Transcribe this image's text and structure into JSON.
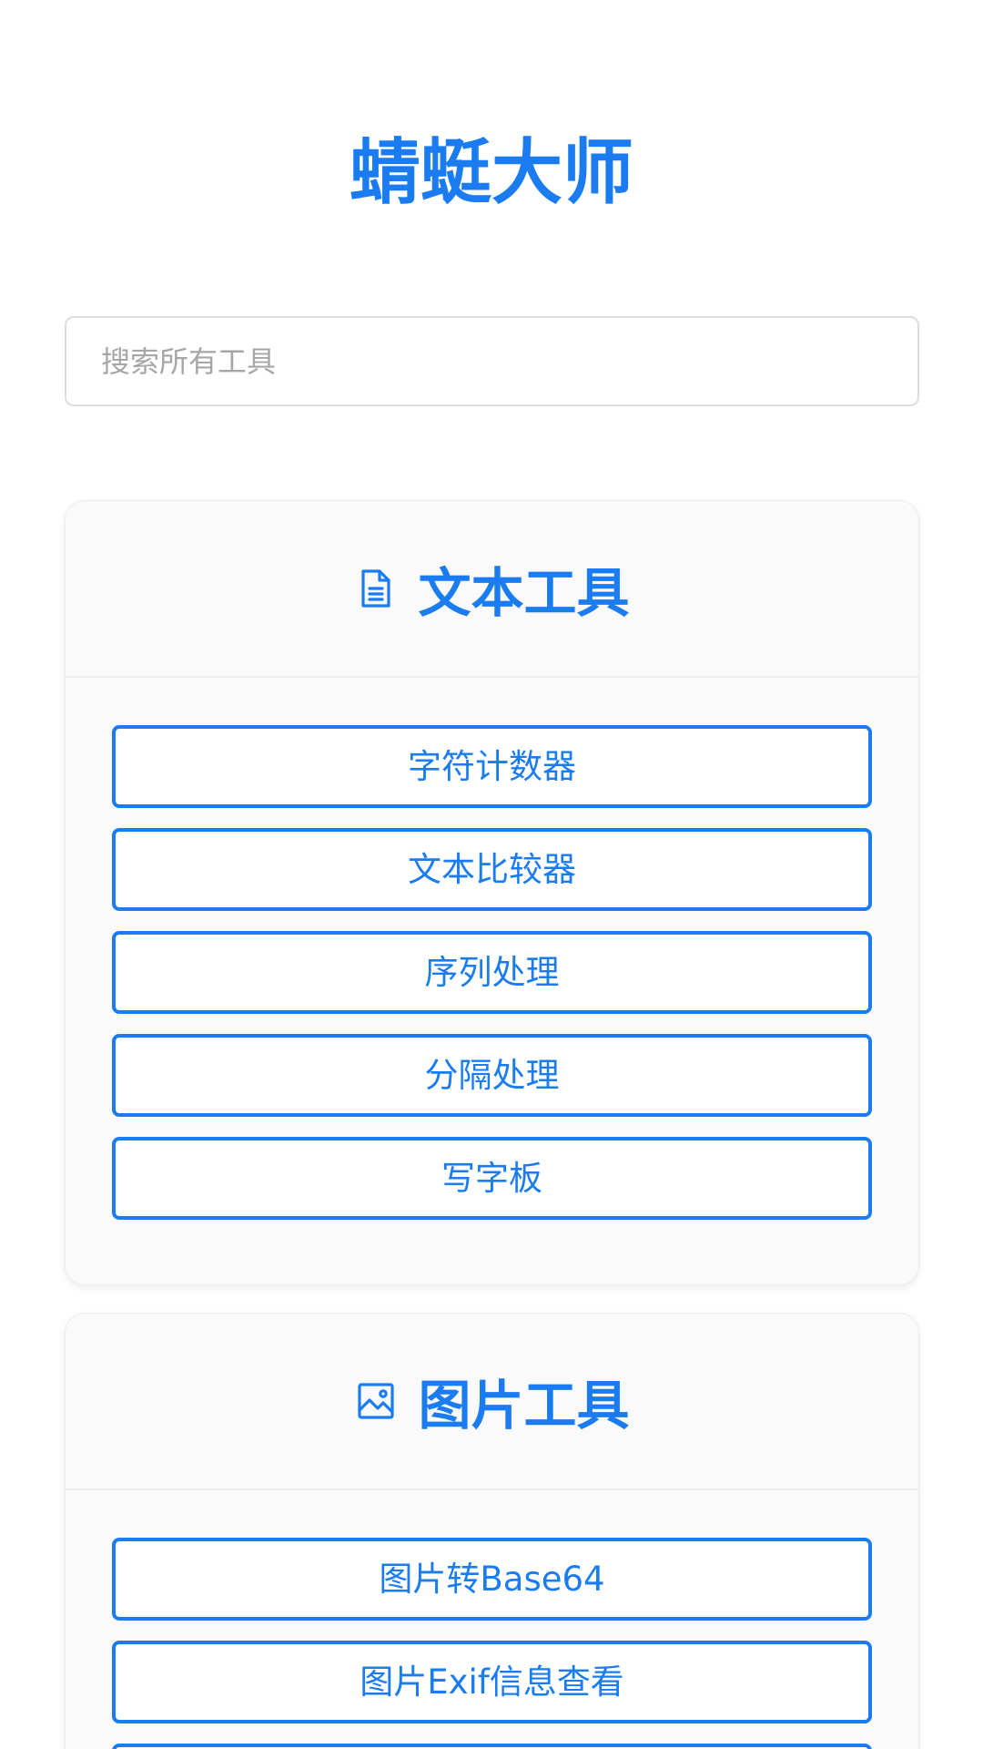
{
  "app": {
    "title": "蜻蜓大师"
  },
  "search": {
    "placeholder": "搜索所有工具",
    "value": ""
  },
  "sections": [
    {
      "icon": "document-icon",
      "title": "文本工具",
      "tools": [
        "字符计数器",
        "文本比较器",
        "序列处理",
        "分隔处理",
        "写字板"
      ]
    },
    {
      "icon": "image-icon",
      "title": "图片工具",
      "tools": [
        "图片转Base64",
        "图片Exif信息查看",
        ""
      ]
    }
  ],
  "colors": {
    "accent": "#1a7cf0",
    "card_background": "#fafafa",
    "border": "#dddddd"
  }
}
